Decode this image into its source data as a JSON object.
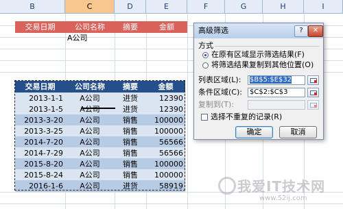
{
  "columns": [
    "B",
    "C",
    "D",
    "E",
    "F",
    "G",
    "H",
    "I"
  ],
  "criteria": {
    "headers": [
      "交易日期",
      "公司名称",
      "摘要",
      "金额"
    ],
    "value": "A公司"
  },
  "table": {
    "headers": [
      "交易日期",
      "公司名称",
      "摘要",
      "金额"
    ],
    "rows": [
      [
        "2013-1-1",
        "A公司",
        "进货",
        "12390"
      ],
      [
        "2013-1-5",
        "A公司",
        "进货",
        "12390"
      ],
      [
        "2013-3-20",
        "A公司",
        "销售",
        "100000"
      ],
      [
        "2013-3-25",
        "A公司",
        "销售",
        "100000"
      ],
      [
        "2014-7-20",
        "A公司",
        "销售",
        "56566"
      ],
      [
        "2014-7-29",
        "A公司",
        "销售",
        "56566"
      ],
      [
        "2015-8-20",
        "A公司",
        "销售",
        "100000"
      ],
      [
        "2015-8-24",
        "A公司",
        "销售",
        "100000"
      ],
      [
        "2016-1-6",
        "A公司",
        "进货",
        "58919"
      ]
    ]
  },
  "dialog": {
    "title": "高级筛选",
    "help": "?",
    "close": "✕",
    "group_label": "方式",
    "option_inplace": "在原有区域显示筛选结果(F)",
    "option_copy": "将筛选结果复制到其他位置(O)",
    "list_range_label": "列表区域(L):",
    "list_range_value": "$B$5:$E$32",
    "criteria_range_label": "条件区域(C):",
    "criteria_range_value": "$C$2:$C$3",
    "copy_to_label": "复制到(T):",
    "copy_to_value": "",
    "unique_label": "选择不重复的记录(R)",
    "ok": "确定",
    "cancel": "取消"
  },
  "watermark": {
    "text": "我爱IT技术网",
    "url": "www.52ij.com"
  },
  "colors": {
    "criteria_header": "#d9625b",
    "table_header": "#254f8a",
    "band_dark": "#b8cbe4",
    "band_light": "#dbe5f1"
  }
}
